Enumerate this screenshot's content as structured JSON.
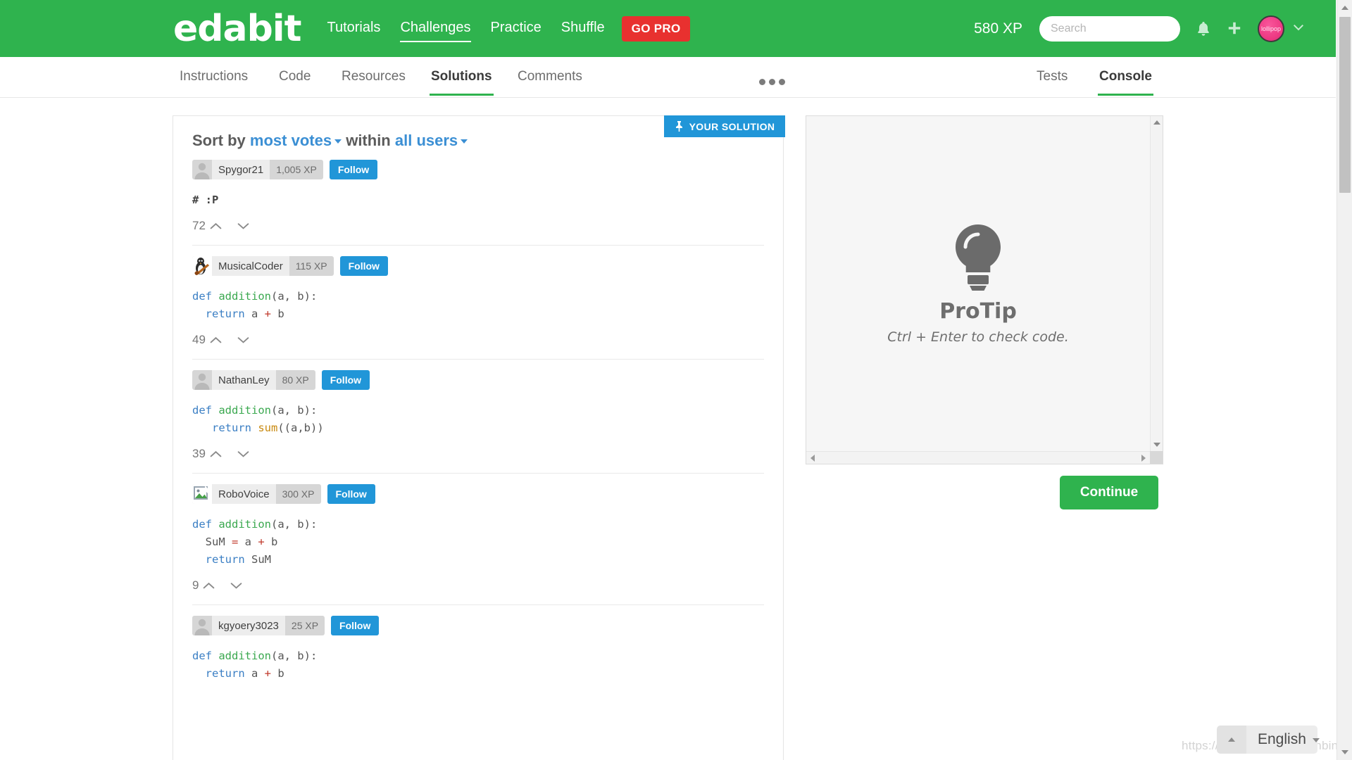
{
  "header": {
    "brand": "edabit",
    "nav": [
      {
        "label": "Tutorials",
        "active": false
      },
      {
        "label": "Challenges",
        "active": true
      },
      {
        "label": "Practice",
        "active": false
      },
      {
        "label": "Shuffle",
        "active": false
      }
    ],
    "go_pro": "GO PRO",
    "xp": "580 XP",
    "search_placeholder": "Search",
    "search_value": "",
    "avatar_label": "lollipop",
    "icons": {
      "bell": "notification-bell-icon",
      "plus": "add-plus-icon",
      "caret": "chevron-down-icon"
    },
    "colors": {
      "brand_green": "#2fb34e",
      "go_pro_red": "#e8312f"
    }
  },
  "tabs": {
    "left": [
      {
        "label": "Instructions",
        "active": false
      },
      {
        "label": "Code",
        "active": false
      },
      {
        "label": "Resources",
        "active": false
      },
      {
        "label": "Solutions",
        "active": true
      },
      {
        "label": "Comments",
        "active": false
      }
    ],
    "overflow": "more-options-dots",
    "right": [
      {
        "label": "Tests",
        "active": false
      },
      {
        "label": "Console",
        "active": true
      }
    ]
  },
  "solutions_panel": {
    "sort_prefix": "Sort by",
    "sort_value": "most votes",
    "within_label": "within",
    "within_value": "all users",
    "your_solution_button": "YOUR SOLUTION",
    "pin_icon": "pin-icon",
    "follow_label": "Follow",
    "items": [
      {
        "username": "Spygor21",
        "xp": "1,005 XP",
        "avatar": "default-person-avatar",
        "votes": "72",
        "code": [
          [
            {
              "t": "# :P",
              "c": "cm"
            }
          ]
        ]
      },
      {
        "username": "MusicalCoder",
        "xp": "115 XP",
        "avatar": "penguin-guitar-avatar",
        "votes": "49",
        "code": [
          [
            {
              "t": "def ",
              "c": "k"
            },
            {
              "t": "addition",
              "c": "fn"
            },
            {
              "t": "(a, b):",
              "c": "pl"
            }
          ],
          [
            {
              "t": "  return ",
              "c": "k"
            },
            {
              "t": "a ",
              "c": "pl"
            },
            {
              "t": "+",
              "c": "op"
            },
            {
              "t": " b",
              "c": "pl"
            }
          ]
        ]
      },
      {
        "username": "NathanLey",
        "xp": "80 XP",
        "avatar": "default-person-avatar",
        "votes": "39",
        "code": [
          [
            {
              "t": "def ",
              "c": "k"
            },
            {
              "t": "addition",
              "c": "fn"
            },
            {
              "t": "(a, b):",
              "c": "pl"
            }
          ],
          [
            {
              "t": "   return ",
              "c": "k"
            },
            {
              "t": "sum",
              "c": "bi"
            },
            {
              "t": "((a,b))",
              "c": "pl"
            }
          ]
        ]
      },
      {
        "username": "RoboVoice",
        "xp": "300 XP",
        "avatar": "broken-image-avatar",
        "votes": "9",
        "code": [
          [
            {
              "t": "def ",
              "c": "k"
            },
            {
              "t": "addition",
              "c": "fn"
            },
            {
              "t": "(a, b):",
              "c": "pl"
            }
          ],
          [
            {
              "t": "  SuM ",
              "c": "pl"
            },
            {
              "t": "=",
              "c": "op"
            },
            {
              "t": " a ",
              "c": "pl"
            },
            {
              "t": "+",
              "c": "op"
            },
            {
              "t": " b",
              "c": "pl"
            }
          ],
          [
            {
              "t": "  return ",
              "c": "k"
            },
            {
              "t": "SuM",
              "c": "pl"
            }
          ]
        ]
      },
      {
        "username": "kgyoery3023",
        "xp": "25 XP",
        "avatar": "default-person-avatar",
        "votes": "",
        "code": [
          [
            {
              "t": "def ",
              "c": "k"
            },
            {
              "t": "addition",
              "c": "fn"
            },
            {
              "t": "(a, b):",
              "c": "pl"
            }
          ],
          [
            {
              "t": "  return ",
              "c": "k"
            },
            {
              "t": "a ",
              "c": "pl"
            },
            {
              "t": "+",
              "c": "op"
            },
            {
              "t": " b",
              "c": "pl"
            }
          ]
        ]
      }
    ]
  },
  "console_panel": {
    "icon": "lightbulb-icon",
    "title": "ProTip",
    "subtitle": "Ctrl + Enter to check code.",
    "continue_label": "Continue"
  },
  "footer": {
    "language": "English",
    "watermark": "https://blog.csdn.net/chenbingcai"
  }
}
